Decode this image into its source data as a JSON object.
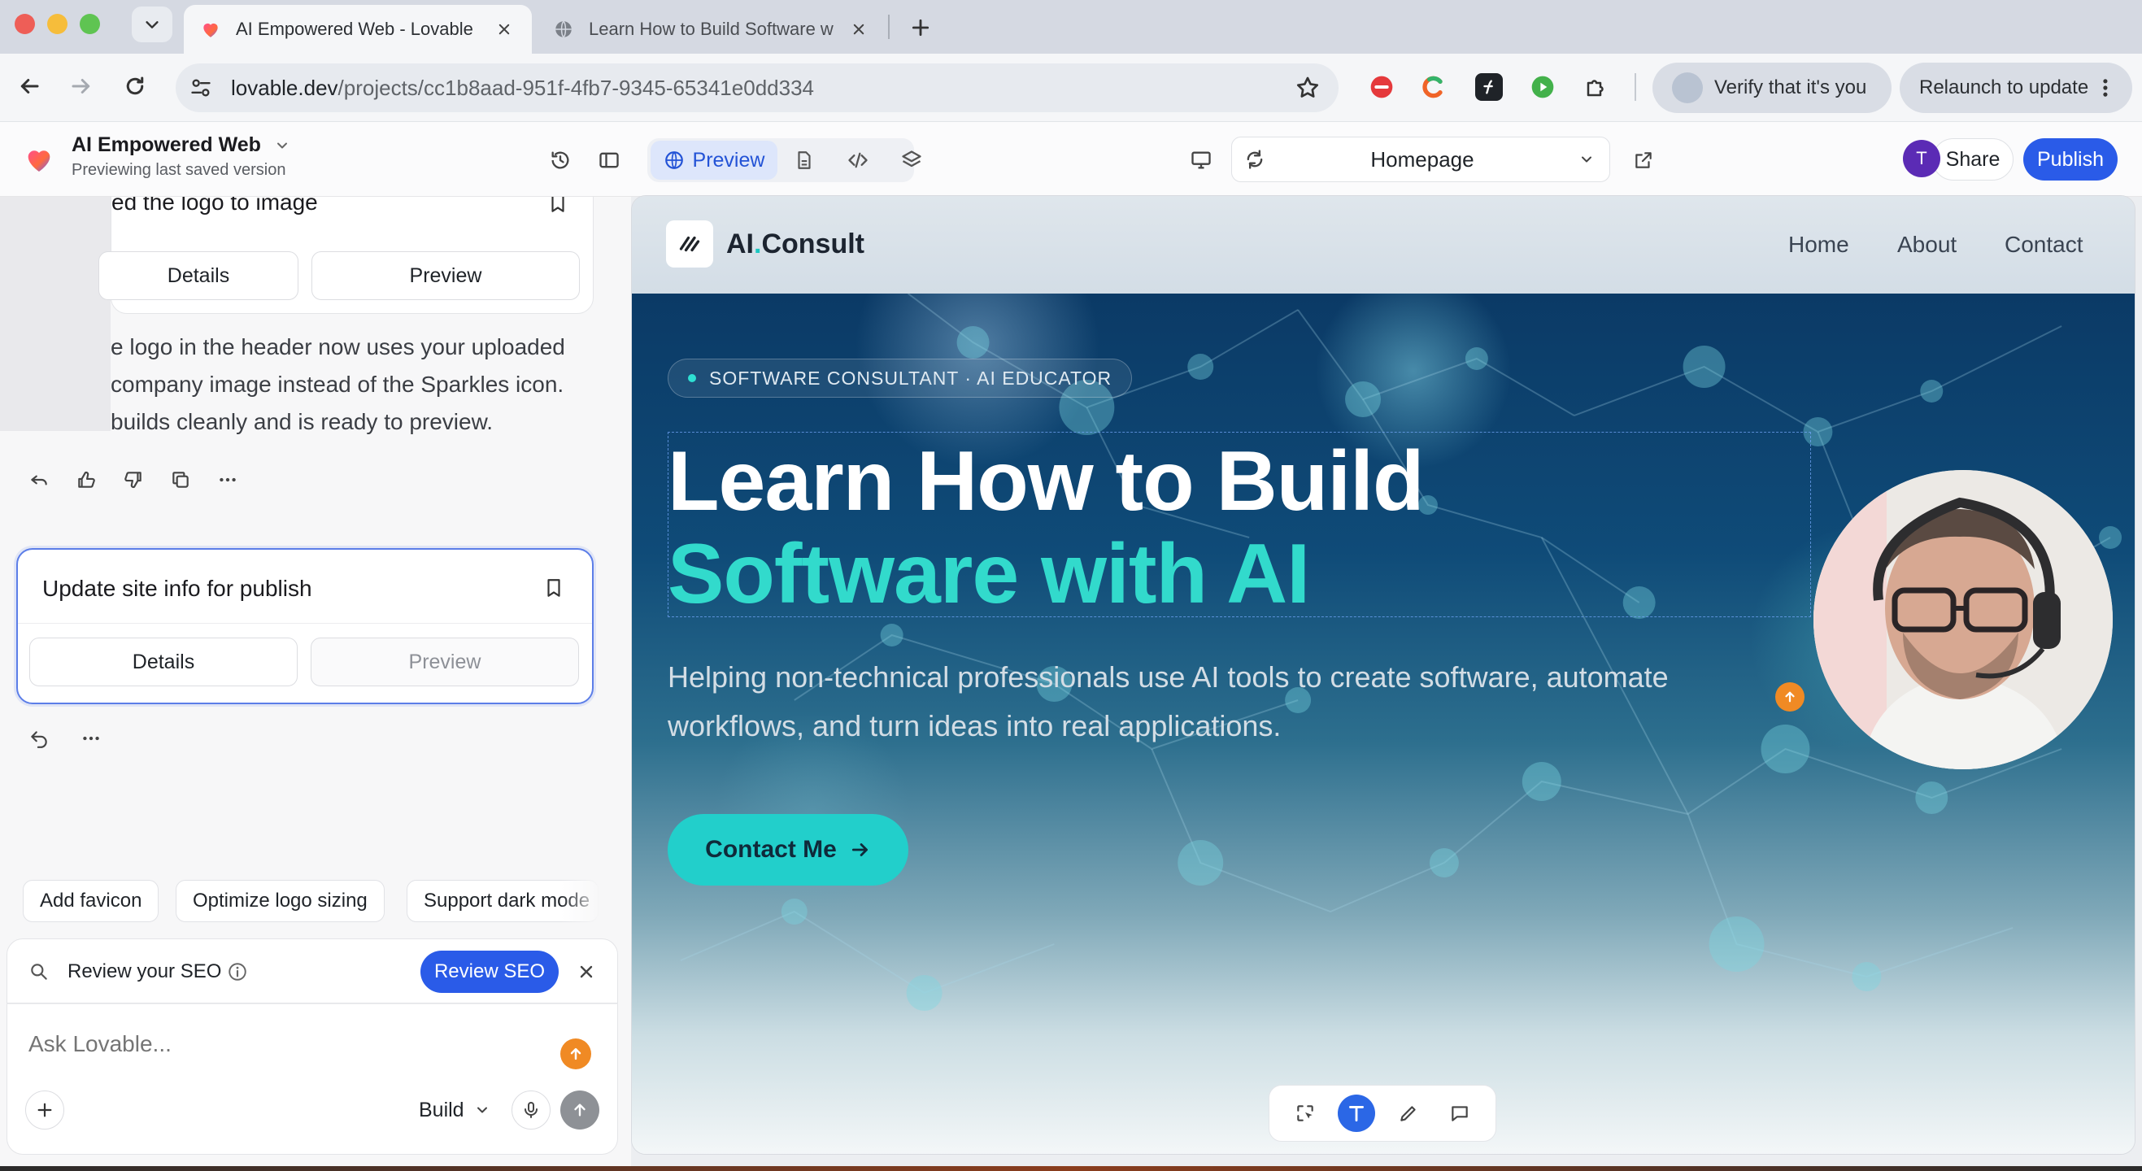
{
  "browser": {
    "tabs": [
      {
        "title": "AI Empowered Web - Lovable",
        "active": true
      },
      {
        "title": "Learn How to Build Software w",
        "active": false
      }
    ],
    "url_host": "lovable.dev",
    "url_path": "/projects/cc1b8aad-951f-4fb7-9345-65341e0dd334",
    "verify_label": "Verify that it's you",
    "relaunch_label": "Relaunch to update"
  },
  "app_header": {
    "project_title": "AI Empowered Web",
    "project_subtitle": "Previewing last saved version",
    "preview_label": "Preview",
    "route_select": "Homepage",
    "avatar_initial": "T",
    "share_label": "Share",
    "publish_label": "Publish",
    "accent": "#2a5be8"
  },
  "chat": {
    "previous_card": {
      "title": "ed the logo to image",
      "details_label": "Details",
      "preview_label": "Preview"
    },
    "assistant_message": [
      "e logo in the header now uses your uploaded",
      "company image instead of the Sparkles icon.",
      "builds cleanly and is ready to preview."
    ],
    "current_card": {
      "title": "Update site info for publish",
      "details_label": "Details",
      "preview_label": "Preview"
    },
    "suggestions": [
      "Add favicon",
      "Optimize logo sizing",
      "Support dark mode"
    ],
    "seo": {
      "label": "Review your SEO",
      "button": "Review SEO"
    },
    "composer": {
      "placeholder": "Ask Lovable...",
      "mode": "Build"
    }
  },
  "site": {
    "brand_prefix": "AI",
    "brand_dot": ".",
    "brand_suffix": "Consult",
    "nav": [
      "Home",
      "About",
      "Contact"
    ],
    "badge": "SOFTWARE CONSULTANT · AI EDUCATOR",
    "headline_line1": "Learn How to Build",
    "headline_line2": "Software with AI",
    "subheadline": "Helping non-technical professionals use AI tools to create software, automate workflows, and turn ideas into real applications.",
    "cta": "Contact Me",
    "accent": "#32dacc"
  }
}
